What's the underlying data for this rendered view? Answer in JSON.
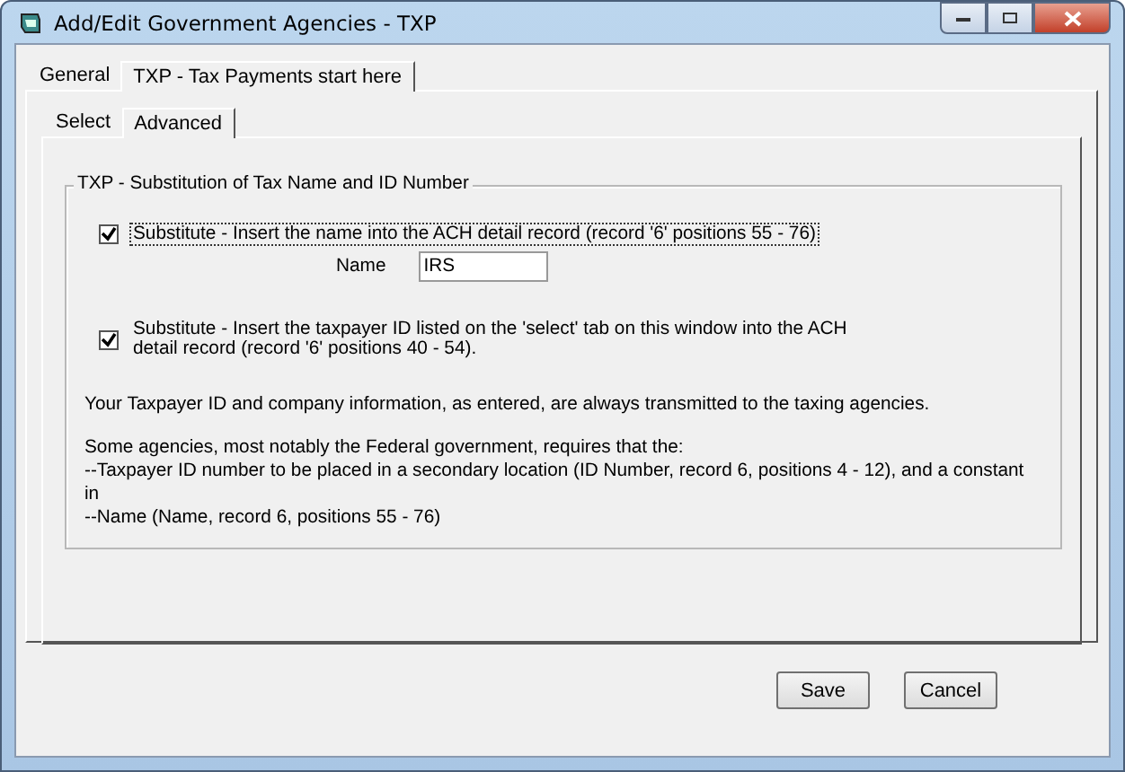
{
  "window": {
    "title": "Add/Edit Government Agencies - TXP"
  },
  "tabs": [
    {
      "label": "General",
      "selected": false
    },
    {
      "label": "TXP - Tax Payments start here",
      "selected": true
    }
  ],
  "subtabs": [
    {
      "label": "Select",
      "selected": false
    },
    {
      "label": "Advanced",
      "selected": true
    }
  ],
  "group": {
    "title": "TXP - Substitution of Tax Name and ID Number",
    "substitute_name": {
      "label": "Substitute - Insert the name into the ACH detail record (record '6' positions 55 - 76)",
      "checked": true,
      "focused": true
    },
    "name_field": {
      "label": "Name",
      "value": "IRS"
    },
    "substitute_id": {
      "label": "Substitute - Insert the taxpayer ID listed on the 'select' tab on this window into the ACH detail record (record '6' positions 40 - 54).",
      "checked": true
    },
    "info": "Your Taxpayer ID and company information, as entered, are always transmitted to the taxing agencies.",
    "notes": [
      "Some agencies, most notably the Federal government, requires that the:",
      "--Taxpayer ID number to be placed in a secondary location (ID Number, record 6, positions 4 - 12), and a constant in",
      "--Name (Name, record 6, positions 55 - 76)"
    ]
  },
  "buttons": [
    "Save",
    "Cancel"
  ]
}
